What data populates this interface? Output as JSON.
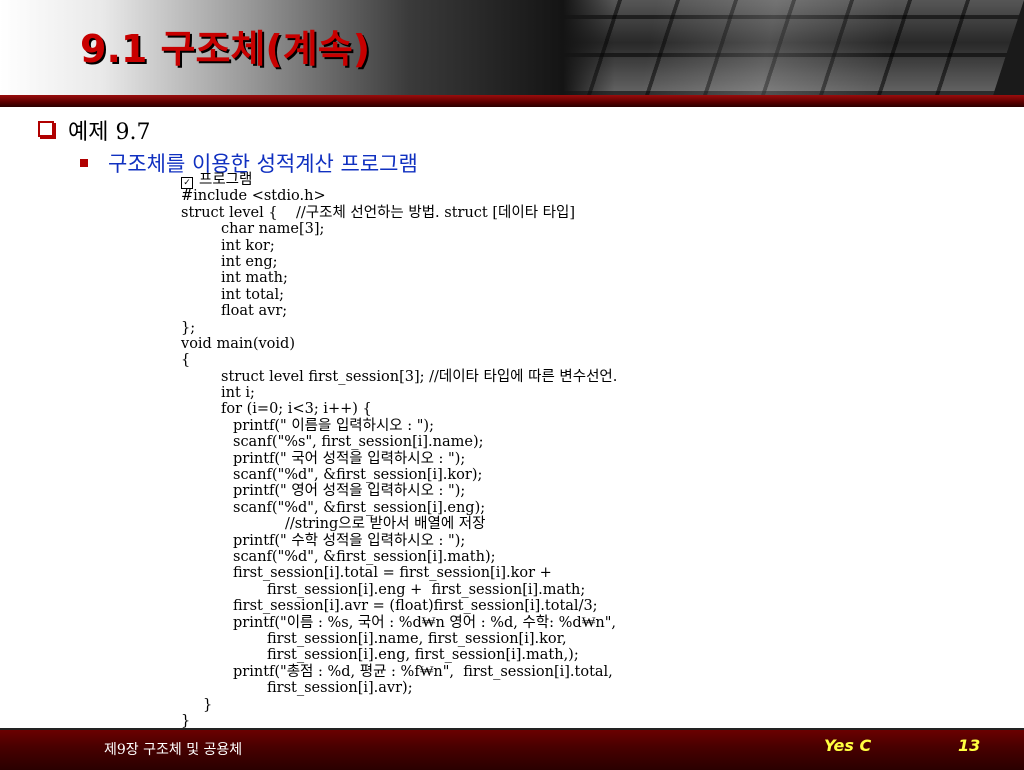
{
  "title": "9.1 구조체(계속)",
  "level1": "예제 9.7",
  "level2": "구조체를 이용한 성적계산 프로그램",
  "code_heading": "프로그램",
  "code_lines": [
    {
      "indent": "i0",
      "text": "#include <stdio.h>"
    },
    {
      "indent": "i0",
      "text": "struct level {    //구조체 선언하는 방법. struct [데이타 타입]"
    },
    {
      "indent": "i1",
      "text": "char name[3];"
    },
    {
      "indent": "i1",
      "text": "int kor;"
    },
    {
      "indent": "i1",
      "text": "int eng;"
    },
    {
      "indent": "i1",
      "text": "int math;"
    },
    {
      "indent": "i1",
      "text": "int total;"
    },
    {
      "indent": "i1",
      "text": "float avr;"
    },
    {
      "indent": "i0",
      "text": "};"
    },
    {
      "indent": "i0",
      "text": "void main(void)"
    },
    {
      "indent": "i0",
      "text": "{"
    },
    {
      "indent": "i1",
      "text": "struct level first_session[3]; //데이타 타입에 따른 변수선언."
    },
    {
      "indent": "i1",
      "text": "int i;"
    },
    {
      "indent": "i1",
      "text": "for (i=0; i<3; i++) {"
    },
    {
      "indent": "i2",
      "text": "printf(\" 이름을 입력하시오 : \");"
    },
    {
      "indent": "i2",
      "text": "scanf(\"%s\", first_session[i].name);"
    },
    {
      "indent": "i2",
      "text": "printf(\" 국어 성적을 입력하시오 : \");"
    },
    {
      "indent": "i2",
      "text": "scanf(\"%d\", &first_session[i].kor);"
    },
    {
      "indent": "i2",
      "text": "printf(\" 영어 성적을 입력하시오 : \");"
    },
    {
      "indent": "i2",
      "text": "scanf(\"%d\", &first_session[i].eng);"
    },
    {
      "indent": "i4",
      "text": "//string으로 받아서 배열에 저장"
    },
    {
      "indent": "i2",
      "text": "printf(\" 수학 성적을 입력하시오 : \");"
    },
    {
      "indent": "i2",
      "text": "scanf(\"%d\", &first_session[i].math);"
    },
    {
      "indent": "i2",
      "text": "first_session[i].total = first_session[i].kor +"
    },
    {
      "indent": "i3",
      "text": "first_session[i].eng +  first_session[i].math;"
    },
    {
      "indent": "i2",
      "text": "first_session[i].avr = (float)first_session[i].total/3;"
    },
    {
      "indent": "i2",
      "text": "printf(\"이름 : %s, 국어 : %d₩n 영어 : %d, 수학: %d₩n\","
    },
    {
      "indent": "i3",
      "text": "first_session[i].name, first_session[i].kor,"
    },
    {
      "indent": "i3",
      "text": "first_session[i].eng, first_session[i].math,);"
    },
    {
      "indent": "i2",
      "text": "printf(\"총점 : %d, 평균 : %f₩n\",  first_session[i].total,"
    },
    {
      "indent": "i3",
      "text": "first_session[i].avr);"
    },
    {
      "indent": "ib",
      "text": "}"
    },
    {
      "indent": "i0",
      "text": "}"
    }
  ],
  "footer": {
    "chapter": "제9장 구조체 및 공용체",
    "brand": "Yes C",
    "page": "13"
  }
}
